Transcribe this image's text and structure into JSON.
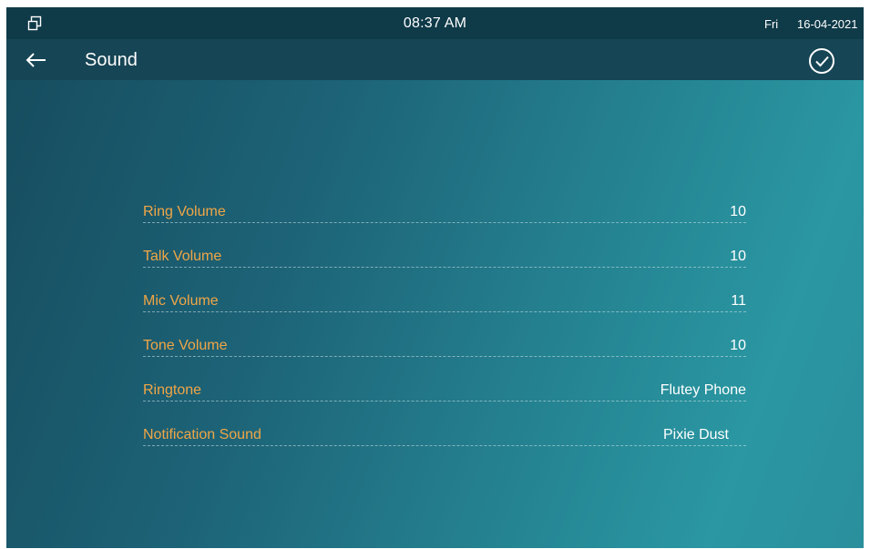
{
  "status_bar": {
    "window_icon": "window-restore-icon",
    "time": "08:37 AM",
    "day": "Fri",
    "date": "16-04-2021"
  },
  "header": {
    "back_icon": "arrow-left-icon",
    "title": "Sound",
    "confirm_icon": "check-circle-icon"
  },
  "settings": [
    {
      "label": "Ring Volume",
      "value": "10"
    },
    {
      "label": "Talk Volume",
      "value": "10"
    },
    {
      "label": "Mic Volume",
      "value": "11"
    },
    {
      "label": "Tone Volume",
      "value": "10"
    },
    {
      "label": "Ringtone",
      "value": "Flutey Phone"
    },
    {
      "label": "Notification Sound",
      "value": "Pixie Dust"
    }
  ],
  "colors": {
    "label": "#f0a646",
    "value": "#ffffff",
    "status_bar_bg": "#0f3a48",
    "title_bar_bg": "#164555"
  }
}
